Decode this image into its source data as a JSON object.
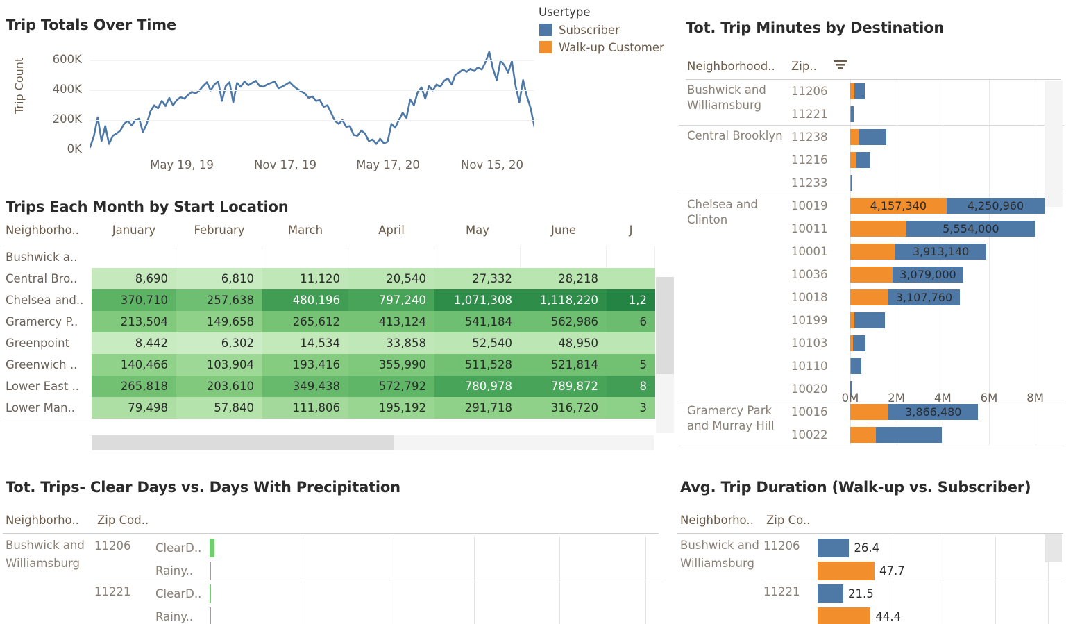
{
  "legend": {
    "title": "Usertype",
    "items": [
      {
        "label": "Subscriber",
        "color": "#4e79a7",
        "icon": "legend-swatch"
      },
      {
        "label": "Walk-up Customer",
        "color": "#f28e2b",
        "icon": "legend-swatch"
      }
    ]
  },
  "trip_totals": {
    "title": "Trip Totals Over Time"
  },
  "heatmap_panel": {
    "title": "Trips Each Month by Start Location"
  },
  "trip_minutes": {
    "title": "Tot. Trip Minutes by Destination",
    "col_neighborhood": "Neighborhood..",
    "col_zip": "Zip..",
    "sort_icon": "sort-descending-icon"
  },
  "clear_days": {
    "title": "Tot. Trips- Clear Days vs. Days With Precipitation",
    "col_neighborhood": "Neighborho..",
    "col_zip": "Zip Cod..",
    "neighborhood": "Bushwick and Williamsburg",
    "groups": [
      {
        "zip": "11206",
        "rows": [
          {
            "label": "ClearD..",
            "value": 1,
            "color": "#6fcf6f"
          },
          {
            "label": "Rainy..",
            "value": 0.35,
            "color": "#9e9e9e"
          }
        ]
      },
      {
        "zip": "11221",
        "rows": [
          {
            "label": "ClearD..",
            "value": 0.3,
            "color": "#6fcf6f"
          },
          {
            "label": "Rainy..",
            "value": 0.25,
            "color": "#9e9e9e"
          }
        ]
      }
    ]
  },
  "avg_duration": {
    "title": "Avg. Trip Duration (Walk-up vs. Subscriber)",
    "col_neighborhood": "Neighborho..",
    "col_zip": "Zip Co..",
    "neighborhood": "Bushwick and Williamsburg",
    "groups": [
      {
        "zip": "11206",
        "rows": [
          {
            "value": "26.4",
            "color": "#4e79a7",
            "series": "Subscriber"
          },
          {
            "value": "47.7",
            "color": "#f28e2b",
            "series": "Walk-up Customer"
          }
        ]
      },
      {
        "zip": "11221",
        "rows": [
          {
            "value": "21.5",
            "color": "#4e79a7",
            "series": "Subscriber"
          },
          {
            "value": "44.4",
            "color": "#f28e2b",
            "series": "Walk-up Customer"
          }
        ]
      }
    ]
  },
  "chart_data": [
    {
      "id": "trip-totals-over-time",
      "type": "line",
      "title": "Trip Totals Over Time",
      "xlabel": "",
      "ylabel": "Trip Count",
      "ylim": [
        0,
        700000
      ],
      "yticks": [
        "0K",
        "200K",
        "400K",
        "600K"
      ],
      "ytick_values": [
        0,
        200000,
        400000,
        600000
      ],
      "xticks": [
        "May 19, 19",
        "Nov 17, 19",
        "May 17, 20",
        "Nov 15, 20"
      ],
      "grid": true,
      "series_color": "#4e79a7",
      "values": [
        20000,
        95000,
        220000,
        60000,
        160000,
        40000,
        95000,
        110000,
        130000,
        175000,
        195000,
        165000,
        200000,
        210000,
        120000,
        175000,
        260000,
        300000,
        280000,
        330000,
        295000,
        350000,
        300000,
        335000,
        355000,
        345000,
        370000,
        390000,
        380000,
        400000,
        430000,
        455000,
        400000,
        440000,
        460000,
        330000,
        430000,
        455000,
        320000,
        450000,
        425000,
        460000,
        435000,
        450000,
        465000,
        430000,
        425000,
        440000,
        450000,
        460000,
        415000,
        425000,
        440000,
        455000,
        430000,
        410000,
        395000,
        380000,
        350000,
        360000,
        330000,
        335000,
        290000,
        300000,
        250000,
        195000,
        175000,
        200000,
        155000,
        160000,
        100000,
        95000,
        130000,
        110000,
        60000,
        70000,
        40000,
        75000,
        45000,
        55000,
        175000,
        150000,
        200000,
        250000,
        215000,
        340000,
        300000,
        390000,
        420000,
        345000,
        430000,
        400000,
        440000,
        425000,
        465000,
        480000,
        440000,
        505000,
        520000,
        540000,
        525000,
        545000,
        530000,
        555000,
        540000,
        590000,
        660000,
        545000,
        470000,
        600000,
        570000,
        520000,
        595000,
        430000,
        320000,
        470000,
        360000,
        280000,
        155000
      ]
    },
    {
      "id": "trips-each-month-by-start-location",
      "type": "table",
      "title": "Trips Each Month by Start Location",
      "col_neighborhood": "Neighborho..",
      "columns": [
        "January",
        "February",
        "March",
        "April",
        "May",
        "June",
        "J"
      ],
      "rows": [
        {
          "name": "Bushwick a..",
          "values": [
            "",
            "",
            "",
            "",
            "",
            "",
            ""
          ],
          "intensity": [
            null,
            null,
            null,
            null,
            null,
            null,
            null
          ]
        },
        {
          "name": "Central Bro..",
          "values": [
            "8,690",
            "6,810",
            "11,120",
            "20,540",
            "27,332",
            "28,218",
            ""
          ],
          "intensity": [
            0.17,
            0.15,
            0.2,
            0.22,
            0.24,
            0.24,
            0.24
          ]
        },
        {
          "name": "Chelsea and..",
          "values": [
            "370,710",
            "257,638",
            "480,196",
            "797,240",
            "1,071,308",
            "1,118,220",
            "1,2"
          ],
          "intensity": [
            0.72,
            0.62,
            0.86,
            0.82,
            0.95,
            0.95,
            1.0
          ]
        },
        {
          "name": "Gramercy P..",
          "values": [
            "213,504",
            "149,658",
            "265,612",
            "413,124",
            "541,184",
            "562,986",
            "6"
          ],
          "intensity": [
            0.52,
            0.45,
            0.58,
            0.58,
            0.62,
            0.62,
            0.64
          ]
        },
        {
          "name": "Greenpoint",
          "values": [
            "8,442",
            "6,302",
            "14,534",
            "33,858",
            "52,540",
            "48,950",
            ""
          ],
          "intensity": [
            0.15,
            0.13,
            0.18,
            0.2,
            0.22,
            0.22,
            0.22
          ]
        },
        {
          "name": "Greenwich ..",
          "values": [
            "140,466",
            "103,904",
            "193,416",
            "355,990",
            "511,528",
            "521,814",
            "5"
          ],
          "intensity": [
            0.44,
            0.38,
            0.5,
            0.53,
            0.6,
            0.6,
            0.6
          ]
        },
        {
          "name": "Lower East ..",
          "values": [
            "265,818",
            "203,610",
            "349,438",
            "572,792",
            "780,978",
            "789,872",
            "8"
          ],
          "intensity": [
            0.6,
            0.52,
            0.66,
            0.7,
            0.82,
            0.82,
            0.85
          ]
        },
        {
          "name": "Lower Man..",
          "values": [
            "79,498",
            "57,840",
            "111,806",
            "195,192",
            "291,718",
            "316,720",
            "3"
          ],
          "intensity": [
            0.3,
            0.26,
            0.35,
            0.4,
            0.45,
            0.45,
            0.46
          ]
        }
      ]
    },
    {
      "id": "tot-trip-minutes-by-destination",
      "type": "bar",
      "title": "Tot. Trip Minutes by Destination",
      "orientation": "horizontal",
      "stacked": true,
      "xlabel": "",
      "xlim": [
        0,
        9000000
      ],
      "xticks": [
        "0M",
        "2M",
        "4M",
        "6M",
        "8M"
      ],
      "xtick_values": [
        0,
        2000000,
        4000000,
        6000000,
        8000000
      ],
      "series": [
        {
          "name": "Walk-up Customer",
          "color": "#f28e2b"
        },
        {
          "name": "Subscriber",
          "color": "#4e79a7"
        }
      ],
      "groups": [
        {
          "neighborhood": "Bushwick and Williamsburg",
          "rows": [
            {
              "zip": "11206",
              "walkup": 180000,
              "subscriber": 440000,
              "label": ""
            },
            {
              "zip": "11221",
              "walkup": 20000,
              "subscriber": 130000,
              "label": ""
            }
          ]
        },
        {
          "neighborhood": "Central Brooklyn",
          "rows": [
            {
              "zip": "11238",
              "walkup": 400000,
              "subscriber": 1160000,
              "label": ""
            },
            {
              "zip": "11216",
              "walkup": 280000,
              "subscriber": 580000,
              "label": ""
            },
            {
              "zip": "11233",
              "walkup": 15000,
              "subscriber": 80000,
              "label": ""
            }
          ]
        },
        {
          "neighborhood": "Chelsea and Clinton",
          "rows": [
            {
              "zip": "10019",
              "walkup": 4157340,
              "subscriber": 4250960,
              "label_walkup": "4,157,340",
              "label_subscriber": "4,250,960"
            },
            {
              "zip": "10011",
              "walkup": 2440000,
              "subscriber": 5554000,
              "label_subscriber": "5,554,000"
            },
            {
              "zip": "10001",
              "walkup": 1960000,
              "subscriber": 3913140,
              "label_subscriber": "3,913,140"
            },
            {
              "zip": "10036",
              "walkup": 1820000,
              "subscriber": 3079000,
              "label_subscriber": "3,079,000"
            },
            {
              "zip": "10018",
              "walkup": 1640000,
              "subscriber": 3107760,
              "label_subscriber": "3,107,760"
            },
            {
              "zip": "10199",
              "walkup": 190000,
              "subscriber": 1300000,
              "label": ""
            },
            {
              "zip": "10103",
              "walkup": 130000,
              "subscriber": 540000,
              "label": ""
            },
            {
              "zip": "10110",
              "walkup": 40000,
              "subscriber": 430000,
              "label": ""
            },
            {
              "zip": "10020",
              "walkup": 10000,
              "subscriber": 80000,
              "label": ""
            }
          ]
        },
        {
          "neighborhood": "Gramercy Park and Murray Hill",
          "rows": [
            {
              "zip": "10016",
              "walkup": 1660000,
              "subscriber": 3866480,
              "label_subscriber": "3,866,480"
            },
            {
              "zip": "10022",
              "walkup": 1120000,
              "subscriber": 2840000,
              "label": ""
            }
          ]
        }
      ]
    },
    {
      "id": "tot-trips-clear-vs-precipitation",
      "type": "bar",
      "title": "Tot. Trips- Clear Days vs. Days With Precipitation",
      "orientation": "horizontal",
      "categories": [
        "11206 ClearD..",
        "11206 Rainy..",
        "11221 ClearD..",
        "11221 Rainy.."
      ],
      "values": [
        1,
        0.35,
        0.3,
        0.25
      ],
      "grid": true
    },
    {
      "id": "avg-trip-duration-walkup-vs-subscriber",
      "type": "bar",
      "title": "Avg. Trip Duration (Walk-up vs. Subscriber)",
      "orientation": "horizontal",
      "categories": [
        "11206 Subscriber",
        "11206 Walk-up",
        "11221 Subscriber",
        "11221 Walk-up"
      ],
      "values": [
        26.4,
        47.7,
        21.5,
        44.4
      ],
      "series": [
        {
          "name": "Subscriber",
          "color": "#4e79a7"
        },
        {
          "name": "Walk-up Customer",
          "color": "#f28e2b"
        }
      ],
      "grid": true
    }
  ]
}
